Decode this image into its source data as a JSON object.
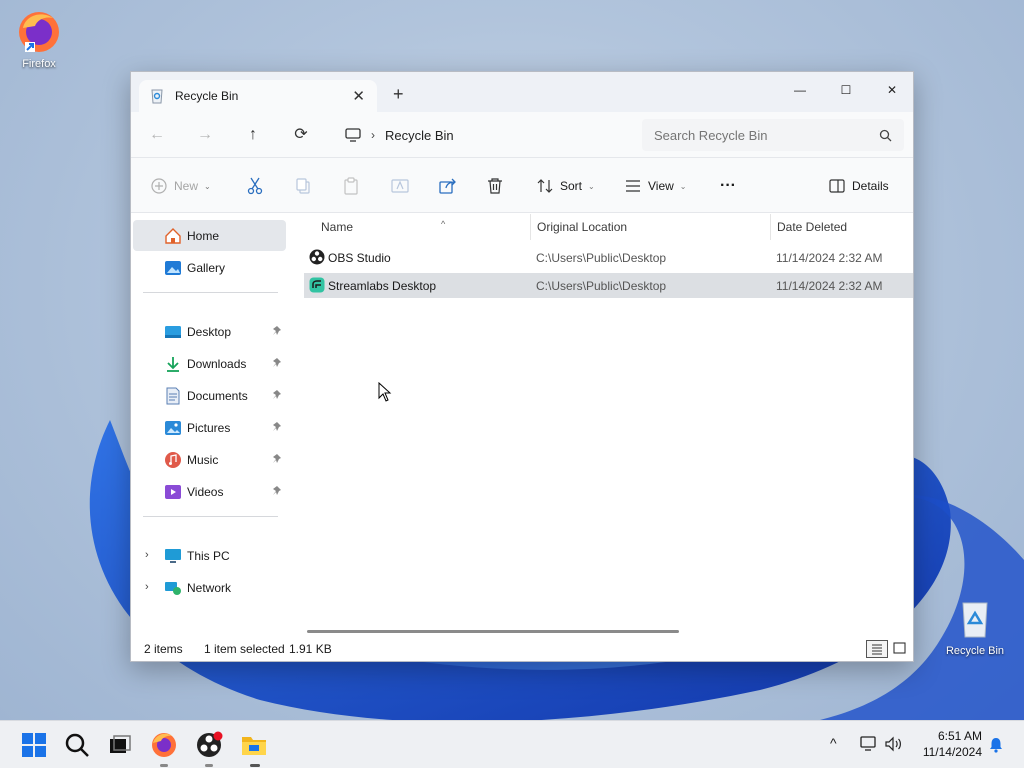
{
  "desktop": {
    "icons": [
      {
        "label": "Firefox",
        "icon": "firefox-icon"
      },
      {
        "label": "Recycle Bin",
        "icon": "recycle-bin-icon"
      }
    ]
  },
  "window": {
    "tab_title": "Recycle Bin",
    "tab_close": "✕",
    "new_tab": "+",
    "controls": {
      "minimize": "—",
      "maximize": "☐",
      "close": "✕"
    }
  },
  "address": {
    "back": "←",
    "forward": "→",
    "up": "↑",
    "refresh": "⟳",
    "separator": "›",
    "breadcrumb": "Recycle Bin",
    "search_placeholder": "Search Recycle Bin"
  },
  "toolbar": {
    "new_label": "New",
    "sort_label": "Sort",
    "view_label": "View",
    "more_label": "···",
    "details_label": "Details",
    "chevron": "⌄"
  },
  "sidebar": {
    "items": [
      {
        "label": "Home",
        "icon": "home-icon"
      },
      {
        "label": "Gallery",
        "icon": "gallery-icon"
      },
      {
        "label": "Desktop",
        "icon": "desktop-folder-icon"
      },
      {
        "label": "Downloads",
        "icon": "downloads-icon"
      },
      {
        "label": "Documents",
        "icon": "documents-icon"
      },
      {
        "label": "Pictures",
        "icon": "pictures-icon"
      },
      {
        "label": "Music",
        "icon": "music-icon"
      },
      {
        "label": "Videos",
        "icon": "videos-icon"
      },
      {
        "label": "This PC",
        "icon": "this-pc-icon"
      },
      {
        "label": "Network",
        "icon": "network-icon"
      }
    ],
    "expander": "›"
  },
  "columns": {
    "name": "Name",
    "location": "Original Location",
    "date": "Date Deleted",
    "sort_caret": "^"
  },
  "files": [
    {
      "name": "OBS Studio",
      "location": "C:\\Users\\Public\\Desktop",
      "date": "11/14/2024 2:32 AM",
      "icon": "obs-icon"
    },
    {
      "name": "Streamlabs Desktop",
      "location": "C:\\Users\\Public\\Desktop",
      "date": "11/14/2024 2:32 AM",
      "icon": "streamlabs-icon"
    }
  ],
  "status": {
    "count": "2 items",
    "selection": "1 item selected",
    "size": "1.91 KB"
  },
  "taskbar": {
    "tray_expand": "^",
    "time": "6:51 AM",
    "date": "11/14/2024"
  },
  "colors": {
    "accent": "#0067c0",
    "selected_row": "#dcdfe3",
    "window_bg": "#ffffff"
  }
}
